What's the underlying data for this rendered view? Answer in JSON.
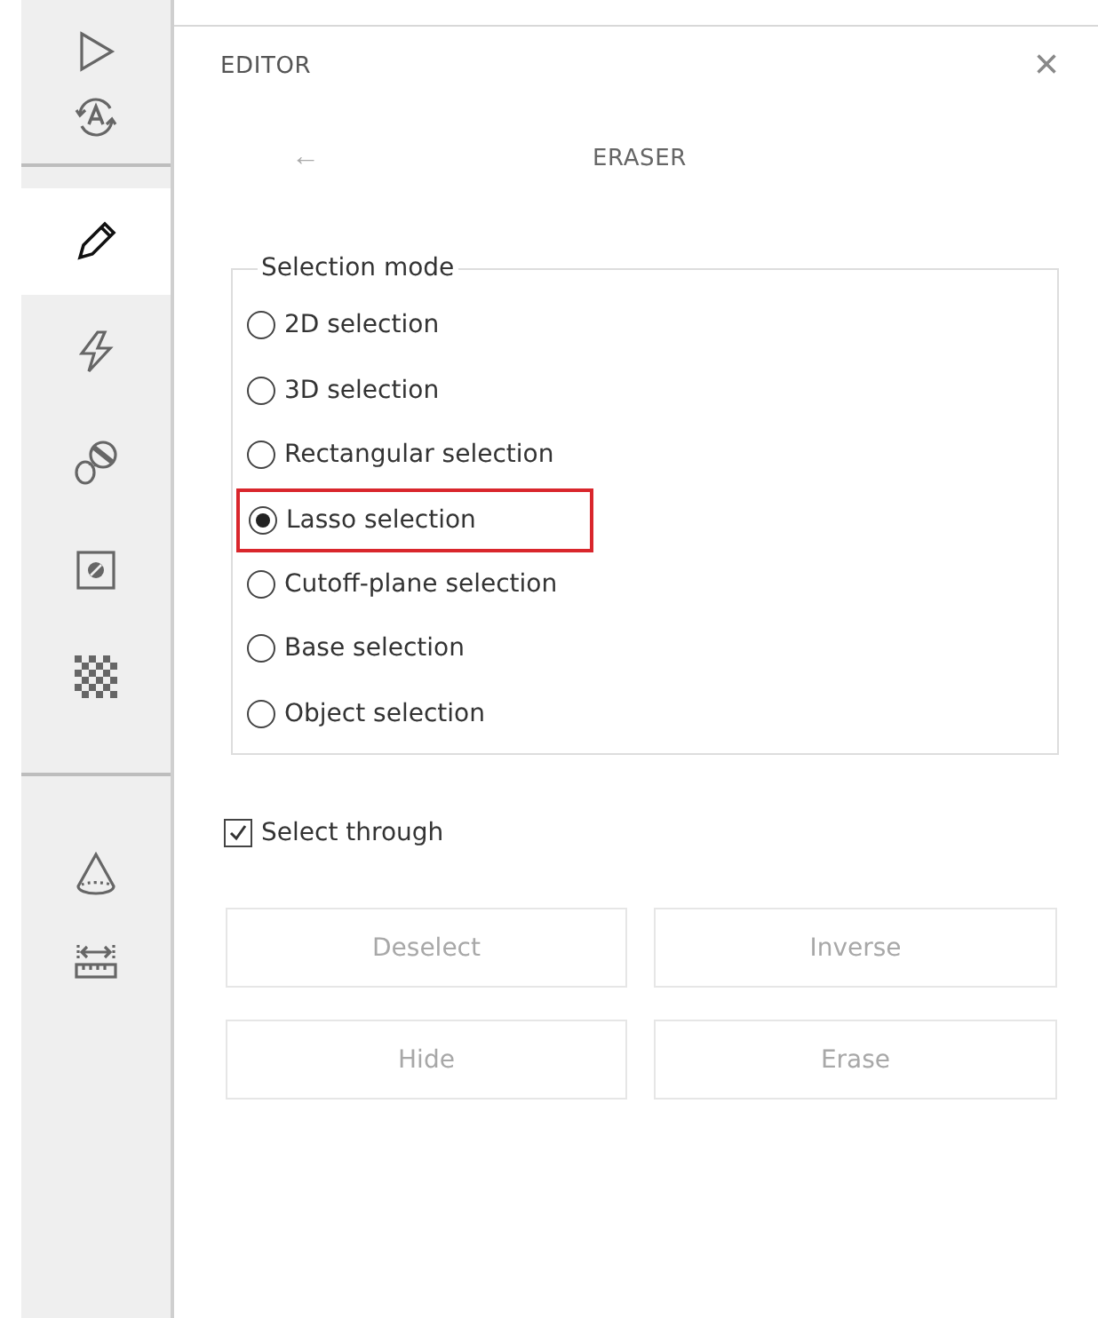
{
  "sidebar": {
    "groups": [
      {
        "items": [
          {
            "selected": false
          },
          {
            "selected": false
          }
        ]
      },
      {
        "items": [
          {
            "selected": true
          },
          {
            "selected": false
          },
          {
            "selected": false
          },
          {
            "selected": false
          },
          {
            "selected": false
          }
        ]
      },
      {
        "items": [
          {
            "selected": false
          },
          {
            "selected": false
          }
        ]
      }
    ]
  },
  "panel": {
    "title": "EDITOR",
    "close": "×",
    "back": "←",
    "subtitle": "ERASER"
  },
  "selection_mode": {
    "legend": "Selection mode",
    "options": [
      {
        "label": "2D selection",
        "selected": false,
        "highlighted": false
      },
      {
        "label": "3D selection",
        "selected": false,
        "highlighted": false
      },
      {
        "label": "Rectangular selection",
        "selected": false,
        "highlighted": false
      },
      {
        "label": "Lasso selection",
        "selected": true,
        "highlighted": true
      },
      {
        "label": "Cutoff-plane selection",
        "selected": false,
        "highlighted": false
      },
      {
        "label": "Base selection",
        "selected": false,
        "highlighted": false
      },
      {
        "label": "Object selection",
        "selected": false,
        "highlighted": false
      }
    ]
  },
  "select_through": {
    "label": "Select through",
    "checked": true
  },
  "buttons": [
    {
      "label": "Deselect",
      "disabled": true
    },
    {
      "label": "Inverse",
      "disabled": true
    },
    {
      "label": "Hide",
      "disabled": true
    },
    {
      "label": "Erase",
      "disabled": true
    }
  ]
}
